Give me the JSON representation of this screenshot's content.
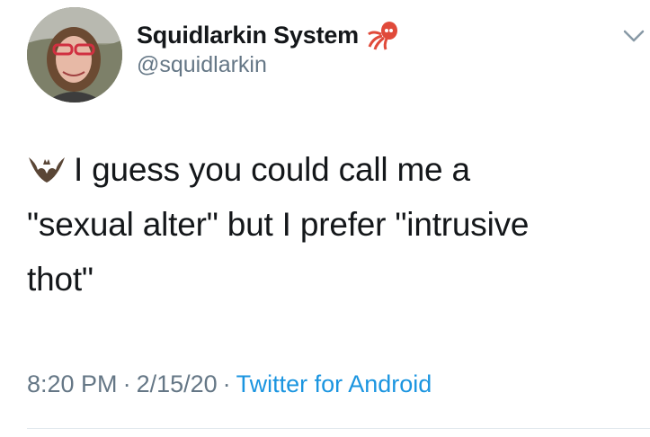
{
  "author": {
    "display_name": "Squidlarkin System",
    "name_emoji_icon": "squid-icon",
    "handle": "@squidlarkin",
    "avatar_icon": "avatar"
  },
  "tweet": {
    "leading_emoji_icon": "bat-icon",
    "text": "I guess you could call me a\n\"sexual alter\" but I prefer \"intrusive\nthot\"",
    "time": "8:20 PM",
    "separator": "·",
    "date": "2/15/20",
    "source": "Twitter for Android"
  },
  "menu": {
    "icon": "chevron-down-icon"
  },
  "colors": {
    "text": "#14171a",
    "secondary": "#657786",
    "link": "#1b95e0",
    "divider": "#e1e8ed"
  }
}
